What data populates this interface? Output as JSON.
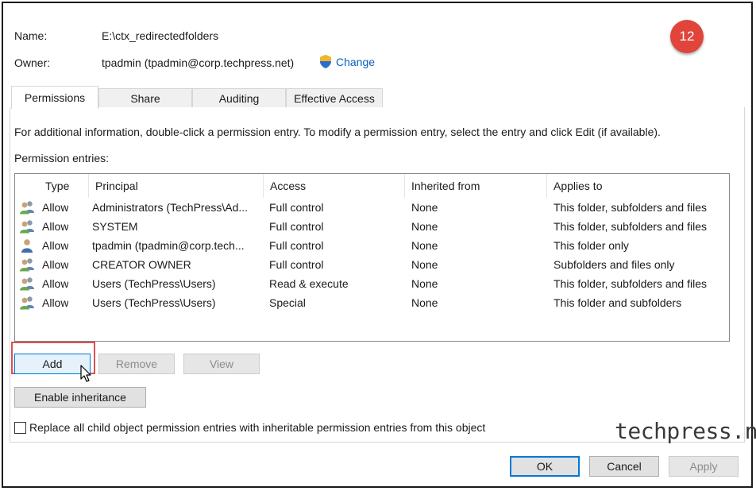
{
  "header": {
    "name_label": "Name:",
    "name_value": "E:\\ctx_redirectedfolders",
    "owner_label": "Owner:",
    "owner_value": "tpadmin (tpadmin@corp.techpress.net)",
    "change_label": "Change"
  },
  "step_badge": "12",
  "tabs": [
    {
      "label": "Permissions",
      "active": true
    },
    {
      "label": "Share",
      "active": false
    },
    {
      "label": "Auditing",
      "active": false
    },
    {
      "label": "Effective Access",
      "active": false
    }
  ],
  "info_text": "For additional information, double-click a permission entry. To modify a permission entry, select the entry and click Edit (if available).",
  "entries_label": "Permission entries:",
  "table": {
    "columns": [
      "Type",
      "Principal",
      "Access",
      "Inherited from",
      "Applies to"
    ],
    "rows": [
      {
        "icon": "group-users-icon",
        "type": "Allow",
        "principal": "Administrators (TechPress\\Ad...",
        "access": "Full control",
        "inherited": "None",
        "applies": "This folder, subfolders and files"
      },
      {
        "icon": "group-users-icon",
        "type": "Allow",
        "principal": "SYSTEM",
        "access": "Full control",
        "inherited": "None",
        "applies": "This folder, subfolders and files"
      },
      {
        "icon": "single-user-icon",
        "type": "Allow",
        "principal": "tpadmin (tpadmin@corp.tech...",
        "access": "Full control",
        "inherited": "None",
        "applies": "This folder only"
      },
      {
        "icon": "group-users-icon",
        "type": "Allow",
        "principal": "CREATOR OWNER",
        "access": "Full control",
        "inherited": "None",
        "applies": "Subfolders and files only"
      },
      {
        "icon": "group-users-icon",
        "type": "Allow",
        "principal": "Users (TechPress\\Users)",
        "access": "Read & execute",
        "inherited": "None",
        "applies": "This folder, subfolders and files"
      },
      {
        "icon": "group-users-icon",
        "type": "Allow",
        "principal": "Users (TechPress\\Users)",
        "access": "Special",
        "inherited": "None",
        "applies": "This folder and subfolders"
      }
    ]
  },
  "buttons": {
    "add": "Add",
    "remove": "Remove",
    "view": "View",
    "enable_inheritance": "Enable inheritance",
    "ok": "OK",
    "cancel": "Cancel",
    "apply": "Apply"
  },
  "replace_checkbox_label": "Replace all child object permission entries with inheritable permission entries from this object",
  "replace_checked": false,
  "watermark": "techpress.net",
  "colors": {
    "badge": "#e0443a",
    "highlight": "#d9534f",
    "accent": "#0078d7",
    "link": "#0a5fbf"
  }
}
